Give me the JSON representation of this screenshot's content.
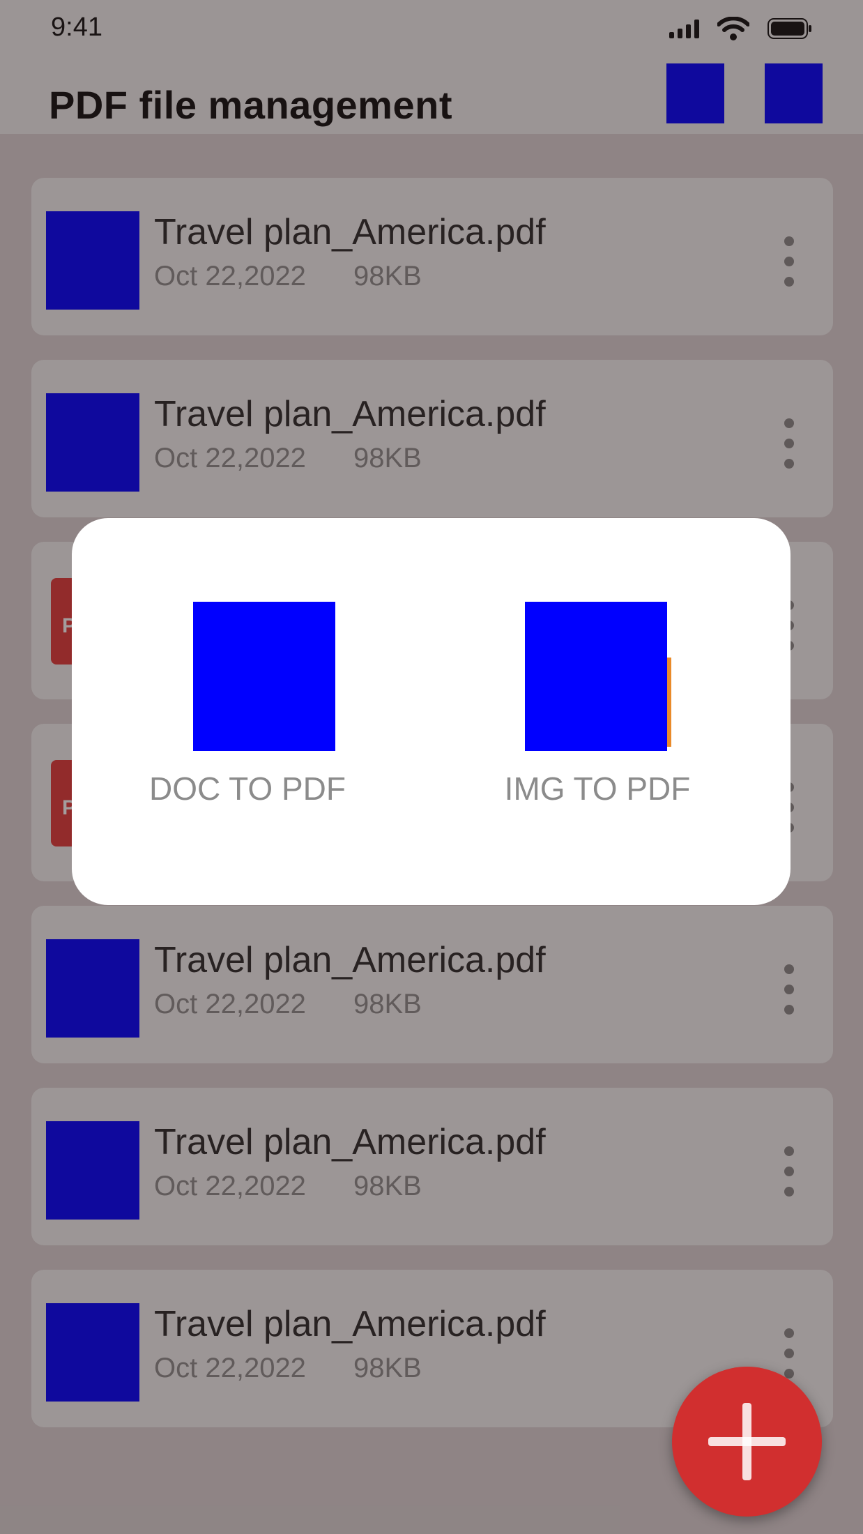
{
  "status_bar": {
    "time": "9:41",
    "icons": [
      "signal-icon",
      "wifi-icon",
      "battery-icon"
    ]
  },
  "header": {
    "title": "PDF file management",
    "action_icons": [
      "header-action-icon-1",
      "header-action-icon-2"
    ]
  },
  "files": [
    {
      "name": "Travel plan_America.pdf",
      "date": "Oct 22,2022",
      "size": "98KB",
      "thumb": "placeholder"
    },
    {
      "name": "Travel plan_America.pdf",
      "date": "Oct 22,2022",
      "size": "98KB",
      "thumb": "placeholder"
    },
    {
      "name": "",
      "date": "",
      "size": "",
      "thumb": "pdf",
      "thumb_letter": "P"
    },
    {
      "name": "",
      "date": "",
      "size": "",
      "thumb": "pdf",
      "thumb_letter": "P"
    },
    {
      "name": "Travel plan_America.pdf",
      "date": "Oct 22,2022",
      "size": "98KB",
      "thumb": "placeholder"
    },
    {
      "name": "Travel plan_America.pdf",
      "date": "Oct 22,2022",
      "size": "98KB",
      "thumb": "placeholder"
    },
    {
      "name": "Travel plan_America.pdf",
      "date": "Oct 22,2022",
      "size": "98KB",
      "thumb": "placeholder"
    }
  ],
  "modal": {
    "options": [
      {
        "label": "DOC TO PDF",
        "icon": "doc-to-pdf-icon"
      },
      {
        "label": "IMG TO PDF",
        "icon": "img-to-pdf-icon"
      }
    ]
  },
  "fab": {
    "icon": "plus-icon"
  },
  "colors": {
    "accent": "#d12f2f",
    "placeholder": "#0000ff",
    "overlay": "rgba(35,22,22,0.42)"
  }
}
